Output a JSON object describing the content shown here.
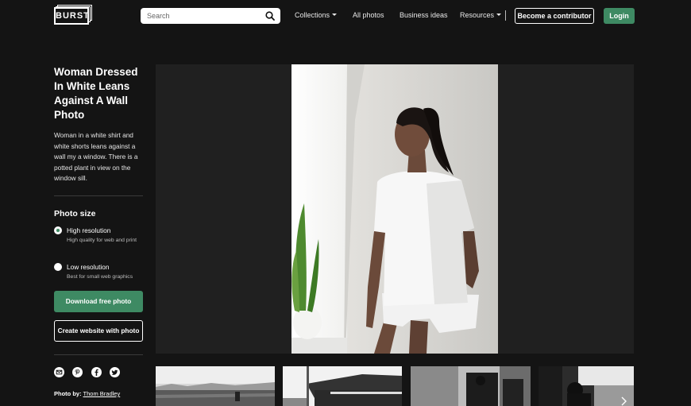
{
  "header": {
    "logo_text": "BURST",
    "search": {
      "placeholder": "Search"
    },
    "nav": {
      "collections": "Collections",
      "all_photos": "All photos",
      "business_ideas": "Business ideas",
      "resources": "Resources"
    },
    "become_contributor": "Become a contributor",
    "login": "Login"
  },
  "sidebar": {
    "title": "Woman Dressed In White Leans Against A Wall Photo",
    "description": "Woman in a white shirt and white shorts leans against a wall my a window. There is a potted plant in view on the window sill.",
    "photo_size_heading": "Photo size",
    "options": [
      {
        "label": "High resolution",
        "sub": "High quality for web and print",
        "selected": true
      },
      {
        "label": "Low resolution",
        "sub": "Best for small web graphics",
        "selected": false
      }
    ],
    "download_label": "Download free photo",
    "website_label": "Create website with photo",
    "social_icons": [
      "email-icon",
      "pinterest-icon",
      "facebook-icon",
      "twitter-icon"
    ],
    "photo_by_label": "Photo by:",
    "photographer": "Thom Bradley"
  },
  "colors": {
    "background": "#141414",
    "accent_green": "#3e8a63",
    "panel": "#202020"
  }
}
